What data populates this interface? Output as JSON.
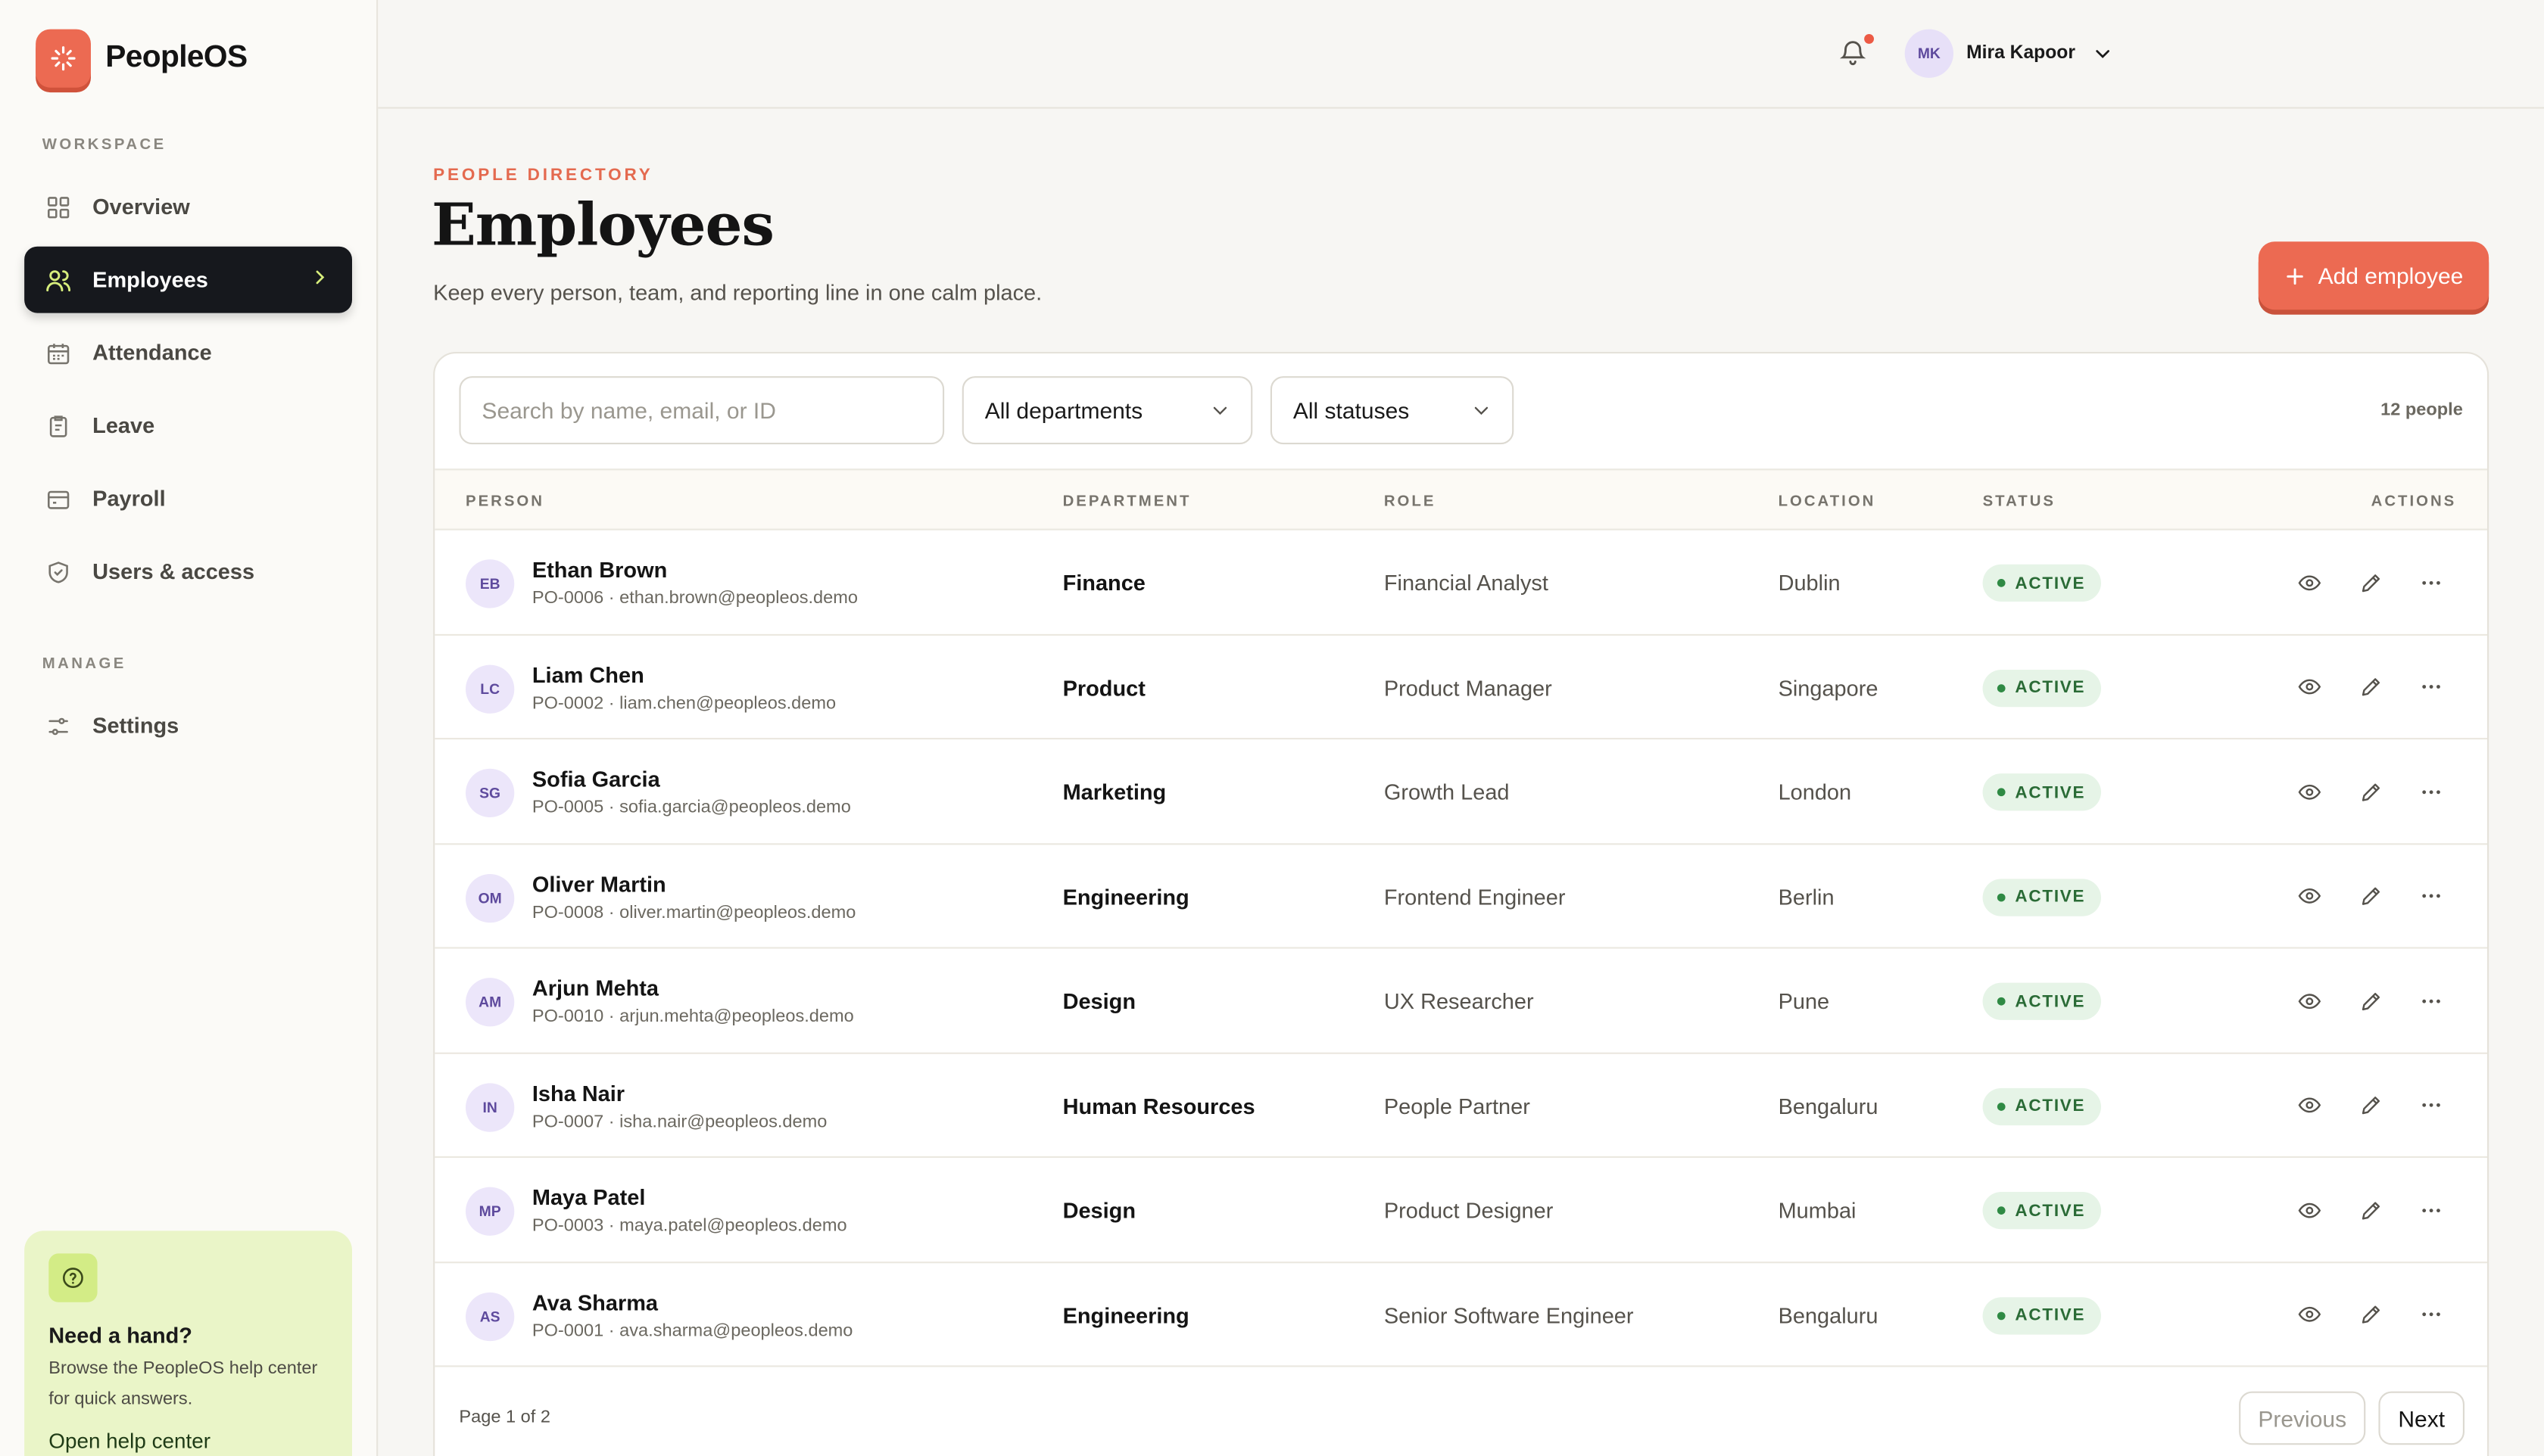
{
  "app": {
    "name": "PeopleOS",
    "brand_color": "#ec6a52"
  },
  "sidebar": {
    "workspace_label": "WORKSPACE",
    "items": [
      {
        "label": "Overview",
        "icon": "grid-icon"
      },
      {
        "label": "Employees",
        "icon": "users-icon",
        "active": true
      },
      {
        "label": "Attendance",
        "icon": "calendar-icon"
      },
      {
        "label": "Leave",
        "icon": "clipboard-icon"
      },
      {
        "label": "Payroll",
        "icon": "wallet-icon"
      },
      {
        "label": "Users & access",
        "icon": "shield-icon"
      }
    ],
    "manage_label": "MANAGE",
    "manage_items": [
      {
        "label": "Settings",
        "icon": "sliders-icon"
      }
    ],
    "help": {
      "title": "Need a hand?",
      "text": "Browse the PeopleOS help center for quick answers.",
      "link": "Open help center"
    }
  },
  "topbar": {
    "user": {
      "initials": "MK",
      "name": "Mira Kapoor"
    },
    "notification_dot": true
  },
  "header": {
    "eyebrow": "PEOPLE DIRECTORY",
    "title": "Employees",
    "subtitle": "Keep every person, team, and reporting line in one calm place.",
    "add_button": "Add employee"
  },
  "filters": {
    "search_placeholder": "Search by name, email, or ID",
    "department": "All departments",
    "status": "All statuses",
    "count": "12 people"
  },
  "table": {
    "columns": [
      "PERSON",
      "DEPARTMENT",
      "ROLE",
      "LOCATION",
      "STATUS",
      "ACTIONS"
    ],
    "rows": [
      {
        "initials": "EB",
        "name": "Ethan Brown",
        "id_email": "PO-0006 · ethan.brown@peopleos.demo",
        "department": "Finance",
        "role": "Financial Analyst",
        "location": "Dublin",
        "status": "ACTIVE"
      },
      {
        "initials": "LC",
        "name": "Liam Chen",
        "id_email": "PO-0002 · liam.chen@peopleos.demo",
        "department": "Product",
        "role": "Product Manager",
        "location": "Singapore",
        "status": "ACTIVE"
      },
      {
        "initials": "SG",
        "name": "Sofia Garcia",
        "id_email": "PO-0005 · sofia.garcia@peopleos.demo",
        "department": "Marketing",
        "role": "Growth Lead",
        "location": "London",
        "status": "ACTIVE"
      },
      {
        "initials": "OM",
        "name": "Oliver Martin",
        "id_email": "PO-0008 · oliver.martin@peopleos.demo",
        "department": "Engineering",
        "role": "Frontend Engineer",
        "location": "Berlin",
        "status": "ACTIVE"
      },
      {
        "initials": "AM",
        "name": "Arjun Mehta",
        "id_email": "PO-0010 · arjun.mehta@peopleos.demo",
        "department": "Design",
        "role": "UX Researcher",
        "location": "Pune",
        "status": "ACTIVE"
      },
      {
        "initials": "IN",
        "name": "Isha Nair",
        "id_email": "PO-0007 · isha.nair@peopleos.demo",
        "department": "Human Resources",
        "role": "People Partner",
        "location": "Bengaluru",
        "status": "ACTIVE"
      },
      {
        "initials": "MP",
        "name": "Maya Patel",
        "id_email": "PO-0003 · maya.patel@peopleos.demo",
        "department": "Design",
        "role": "Product Designer",
        "location": "Mumbai",
        "status": "ACTIVE"
      },
      {
        "initials": "AS",
        "name": "Ava Sharma",
        "id_email": "PO-0001 · ava.sharma@peopleos.demo",
        "department": "Engineering",
        "role": "Senior Software Engineer",
        "location": "Bengaluru",
        "status": "ACTIVE"
      }
    ]
  },
  "pagination": {
    "label": "Page 1 of 2",
    "previous": "Previous",
    "next": "Next"
  }
}
